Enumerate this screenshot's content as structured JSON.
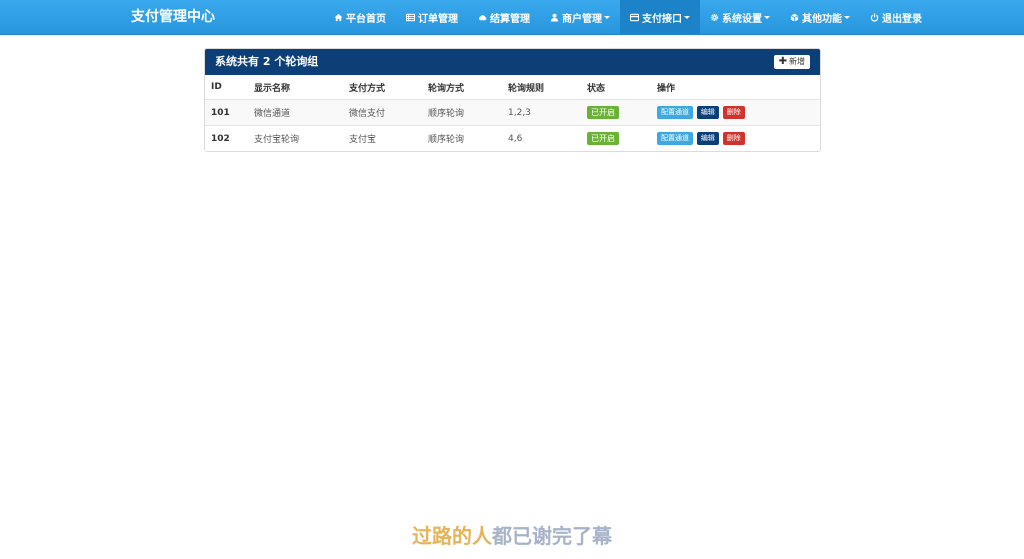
{
  "navbar": {
    "brand": "支付管理中心",
    "items": [
      {
        "icon": "home-icon",
        "label": "平台首页",
        "dropdown": false,
        "active": false
      },
      {
        "icon": "list-icon",
        "label": "订单管理",
        "dropdown": false,
        "active": false
      },
      {
        "icon": "cloud-icon",
        "label": "结算管理",
        "dropdown": false,
        "active": false
      },
      {
        "icon": "user-icon",
        "label": "商户管理",
        "dropdown": true,
        "active": false
      },
      {
        "icon": "credit-card-icon",
        "label": "支付接口",
        "dropdown": true,
        "active": true
      },
      {
        "icon": "gear-icon",
        "label": "系统设置",
        "dropdown": true,
        "active": false
      },
      {
        "icon": "cube-icon",
        "label": "其他功能",
        "dropdown": true,
        "active": false
      },
      {
        "icon": "power-icon",
        "label": "退出登录",
        "dropdown": false,
        "active": false
      }
    ]
  },
  "panel": {
    "title": "系统共有 2 个轮询组",
    "add_label": "新增",
    "columns": [
      "ID",
      "显示名称",
      "支付方式",
      "轮询方式",
      "轮询规则",
      "状态",
      "操作"
    ],
    "rows": [
      {
        "id": "101",
        "name": "微信通道",
        "pay_type": "微信支付",
        "mode": "顺序轮询",
        "rule": "1,2,3",
        "status": "已开启"
      },
      {
        "id": "102",
        "name": "支付宝轮询",
        "pay_type": "支付宝",
        "mode": "顺序轮询",
        "rule": "4,6",
        "status": "已开启"
      }
    ],
    "actions": {
      "config": "配置通道",
      "edit": "编辑",
      "delete": "删除"
    }
  },
  "subtitle": {
    "part_a": "过路的人",
    "part_b": "都已谢完了幕"
  },
  "colors": {
    "navbar": "#2796de",
    "panel_heading": "#0c3f77",
    "status_on": "#6ab236",
    "config_button": "#3ea9e0",
    "delete_button": "#d2322d"
  }
}
